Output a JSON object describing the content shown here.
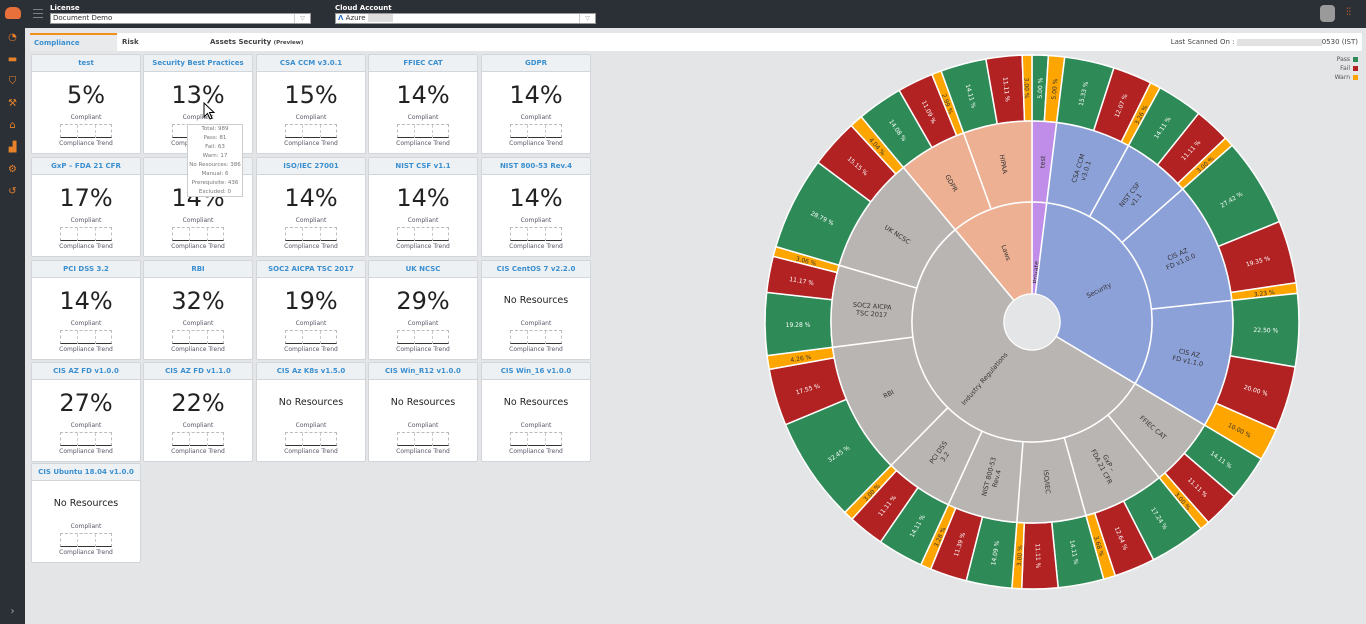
{
  "header": {
    "license_label": "License",
    "license_value": "Document Demo",
    "cloud_label": "Cloud Account",
    "cloud_value": "Azure"
  },
  "tabs": [
    {
      "label": "Compliance"
    },
    {
      "label": "Risk"
    },
    {
      "label": "Assets Security",
      "badge": "(Preview)"
    }
  ],
  "last_scanned": {
    "label": "Last Scanned On :",
    "value_suffix": "0530 (IST)"
  },
  "legend": [
    {
      "label": "Pass",
      "color": "#2e8b57"
    },
    {
      "label": "Fail",
      "color": "#b22222"
    },
    {
      "label": "Warn",
      "color": "#ffa500"
    }
  ],
  "card_labels": {
    "compliant": "Compliant",
    "trend": "Compliance Trend"
  },
  "cards": [
    {
      "title": "test",
      "value": "5%"
    },
    {
      "title": "Security Best Practices",
      "value": "13%"
    },
    {
      "title": "CSA CCM v3.0.1",
      "value": "15%"
    },
    {
      "title": "FFIEC CAT",
      "value": "14%"
    },
    {
      "title": "GDPR",
      "value": "14%"
    },
    {
      "title": "GxP – FDA 21 CFR",
      "value": "17%"
    },
    {
      "title": "",
      "value": "14%"
    },
    {
      "title": "ISO/IEC 27001",
      "value": "14%"
    },
    {
      "title": "NIST CSF v1.1",
      "value": "14%"
    },
    {
      "title": "NIST 800-53 Rev.4",
      "value": "14%"
    },
    {
      "title": "PCI DSS 3.2",
      "value": "14%"
    },
    {
      "title": "RBI",
      "value": "32%"
    },
    {
      "title": "SOC2 AICPA TSC 2017",
      "value": "19%"
    },
    {
      "title": "UK NCSC",
      "value": "29%"
    },
    {
      "title": "CIS CentOS 7 v2.2.0",
      "value": "No Resources"
    },
    {
      "title": "CIS AZ FD v1.0.0",
      "value": "27%"
    },
    {
      "title": "CIS AZ FD v1.1.0",
      "value": "22%"
    },
    {
      "title": "CIS Az K8s v1.5.0",
      "value": "No Resources"
    },
    {
      "title": "CIS Win_R12 v1.0.0",
      "value": "No Resources"
    },
    {
      "title": "CIS Win_16 v1.0.0",
      "value": "No Resources"
    },
    {
      "title": "CIS Ubuntu 18.04 v1.0.0",
      "value": "No Resources"
    }
  ],
  "tooltip": [
    "Total: 989",
    "Pass: 81",
    "Fail: 63",
    "Warn: 17",
    "No Resources: 386",
    "Manual: 6",
    "Prerequisite: 436",
    "Excluded: 0"
  ],
  "chart_data": {
    "type": "sunburst",
    "colors": {
      "pass": "#2e8b57",
      "fail": "#b22222",
      "warn": "#ffa500",
      "Private": "#c08ee8",
      "Security": "#8da1d9",
      "Industry Regulations": "#b9b5b3",
      "Laws": "#eeb092"
    },
    "categories": [
      {
        "name": "Private",
        "standards": [
          {
            "label": [
              "test"
            ],
            "pass": 5.0,
            "fail": 0,
            "warn": 5.0
          }
        ]
      },
      {
        "name": "Security",
        "standards": [
          {
            "label": [
              "CSA CCM",
              "v3.0.1"
            ],
            "pass": 15.33,
            "fail": 12.07,
            "warn": 3.26
          },
          {
            "label": [
              "NIST CSF",
              "v1.1"
            ],
            "pass": 14.11,
            "fail": 11.11,
            "warn": 3.0
          },
          {
            "label": [
              "CIS AZ",
              "FD v1.0.0"
            ],
            "pass": 27.42,
            "fail": 19.35,
            "warn": 3.23
          },
          {
            "label": [
              "CIS AZ",
              "FD v1.1.0"
            ],
            "pass": 22.5,
            "fail": 20.0,
            "warn": 10.0
          }
        ]
      },
      {
        "name": "Industry Regulations",
        "standards": [
          {
            "label": [
              "FFIEC CAT"
            ],
            "pass": 14.11,
            "fail": 11.11,
            "warn": 3.0
          },
          {
            "label": [
              "GxP –",
              "FDA 21 CFR"
            ],
            "pass": 17.24,
            "fail": 12.64,
            "warn": 3.68
          },
          {
            "label": [
              "ISO/IEC"
            ],
            "pass": 14.11,
            "fail": 11.11,
            "warn": 3.0
          },
          {
            "label": [
              "NIST 800-53",
              "Rev.4"
            ],
            "pass": 14.09,
            "fail": 11.39,
            "warn": 3.28
          },
          {
            "label": [
              "PCI DSS",
              "3.2"
            ],
            "pass": 14.11,
            "fail": 11.11,
            "warn": 3.0
          },
          {
            "label": [
              "RBI"
            ],
            "pass": 32.45,
            "fail": 17.55,
            "warn": 4.26
          },
          {
            "label": [
              "SOC2 AICPA",
              "TSC 2017"
            ],
            "pass": 19.28,
            "fail": 11.17,
            "warn": 3.06
          },
          {
            "label": [
              "UK NCSC"
            ],
            "pass": 28.79,
            "fail": 15.15,
            "warn": 4.04
          }
        ]
      },
      {
        "name": "Laws",
        "standards": [
          {
            "label": [
              "GDPR"
            ],
            "pass": 14.08,
            "fail": 11.09,
            "warn": 2.99
          },
          {
            "label": [
              "HIPAA"
            ],
            "pass": 14.11,
            "fail": 11.11,
            "warn": 3.0
          }
        ]
      }
    ]
  }
}
